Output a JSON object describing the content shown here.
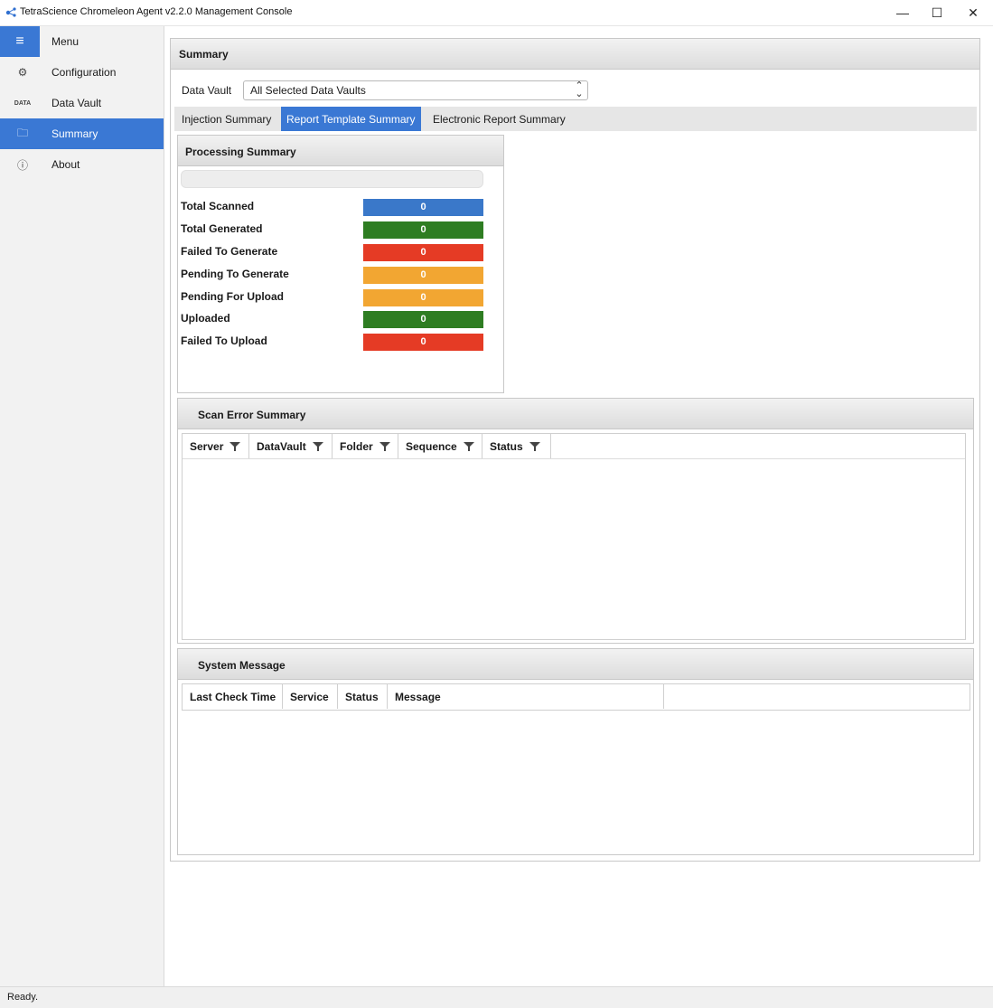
{
  "window": {
    "title": "TetraScience Chromeleon Agent v2.2.0 Management Console",
    "min_glyph": "—",
    "max_glyph": "☐",
    "close_glyph": "✕"
  },
  "sidebar": {
    "items": [
      {
        "label": "Menu",
        "icon": "hamburger-icon",
        "glyph": "≡"
      },
      {
        "label": "Configuration",
        "icon": "gears-icon",
        "glyph": "⚙"
      },
      {
        "label": "Data Vault",
        "icon": "data-vault-icon",
        "glyph": "DATA"
      },
      {
        "label": "Summary",
        "icon": "folder-add-icon",
        "glyph": "🗀"
      },
      {
        "label": "About",
        "icon": "info-icon",
        "glyph": "ⓘ"
      }
    ],
    "active_index": 3
  },
  "main": {
    "header": "Summary",
    "data_vault_label": "Data Vault",
    "data_vault_value": "All Selected Data Vaults",
    "tabs": [
      "Injection Summary",
      "Report Template Summary",
      "Electronic Report Summary"
    ],
    "active_tab": 1
  },
  "processing_summary": {
    "title": "Processing Summary",
    "progress": 0,
    "stats": [
      {
        "label": "Total Scanned",
        "value": "0",
        "color": "#3a78c9"
      },
      {
        "label": "Total Generated",
        "value": "0",
        "color": "#2e7d22"
      },
      {
        "label": "Failed To Generate",
        "value": "0",
        "color": "#e53b25"
      },
      {
        "label": "Pending To Generate",
        "value": "0",
        "color": "#f2a632"
      },
      {
        "label": "Pending For Upload",
        "value": "0",
        "color": "#f2a632"
      },
      {
        "label": "Uploaded",
        "value": "0",
        "color": "#2e7d22"
      },
      {
        "label": "Failed To Upload",
        "value": "0",
        "color": "#e53b25"
      }
    ]
  },
  "scan_error_summary": {
    "title": "Scan Error Summary",
    "columns": [
      "Server",
      "DataVault",
      "Folder",
      "Sequence",
      "Status"
    ]
  },
  "system_message": {
    "title": "System Message",
    "columns": [
      "Last Check Time",
      "Service",
      "Status",
      "Message"
    ]
  },
  "status_bar": {
    "text": "Ready."
  },
  "colors": {
    "accent": "#3a78d4"
  }
}
